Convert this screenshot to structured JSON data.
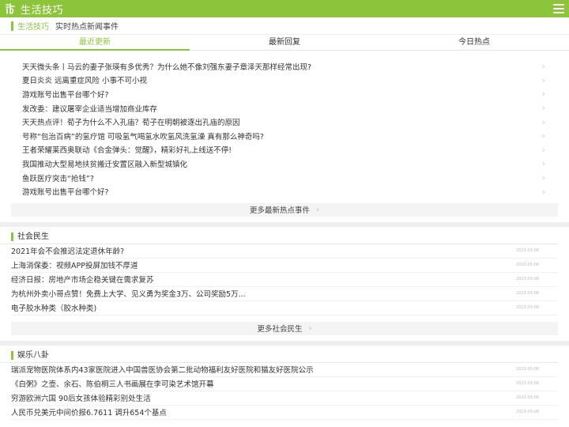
{
  "header": {
    "site_title": "生活技巧",
    "logo_icon": "leaf-logo-icon",
    "menu_icon": "hamburger-menu-icon",
    "brand_color": "#8cc43c"
  },
  "breadcrumb": {
    "section": "生活技巧",
    "page": "实时热点新闻事件"
  },
  "tabs": [
    {
      "label": "最近更新",
      "active": true
    },
    {
      "label": "最新回复",
      "active": false
    },
    {
      "label": "今日热点",
      "active": false
    }
  ],
  "hot_items": [
    "天天微头条丨马云的妻子张瑛有多优秀？为什么她不像刘强东妻子章泽天那样经常出现?",
    "夏日炎炎 远离重症风险 小事不可小视",
    "游戏账号出售平台哪个好?",
    "发改委：建议屠宰企业适当增加商业库存",
    "天天热点评！荀子为什么不入孔庙？荀子在明朝被逐出孔庙的原因",
    "号称“包治百病”的氢疗馆 可吸氢气喝氢水吹氢风洗氢澡 真有那么神奇吗?",
    "王者荣耀莱西奥联动《合金弹头：觉醒》，精彩好礼上线送不停!",
    "我国推动大型易地扶贫搬迁安置区融入新型城镇化",
    "鱼跃医疗突击“抢钱”?",
    "游戏账号出售平台哪个好?"
  ],
  "hot_more": "更多最新热点事件",
  "sections": [
    {
      "title": "社会民生",
      "items": [
        {
          "title": "2021年会不会推迟法定退休年龄?",
          "date": "2023-03-06"
        },
        {
          "title": "上海消保委：视频APP投屏加钱不厚道",
          "date": "2023-03-06"
        },
        {
          "title": "经济日报：房地产市场企稳关键在需求复苏",
          "date": "2023-03-06"
        },
        {
          "title": "为杭州外卖小哥点赞！免费上大学、见义勇为奖金3万、公司奖励5万...",
          "date": "2023-03-06"
        },
        {
          "title": "电子胶水种类（胶水种类)",
          "date": "2023-03-06"
        }
      ],
      "more": "更多社会民生"
    },
    {
      "title": "娱乐八卦",
      "items": [
        {
          "title": "瑞派宠物医院体系内43家医院进入中国兽医协会第二批动物福利友好医院和猫友好医院公示",
          "date": "2023-03-06"
        },
        {
          "title": "《白粥》之壶、余石、陈伯桐三人书画展在李可染艺术馆开幕",
          "date": "2023-03-06"
        },
        {
          "title": "穷游欧洲六国 90后女孩体验精彩别处生活",
          "date": "2023-03-06"
        },
        {
          "title": "人民币兑美元中间价报6.7611 调升654个基点",
          "date": "2023-03-06"
        }
      ]
    }
  ],
  "chevron_icon": "chevron-right-icon"
}
